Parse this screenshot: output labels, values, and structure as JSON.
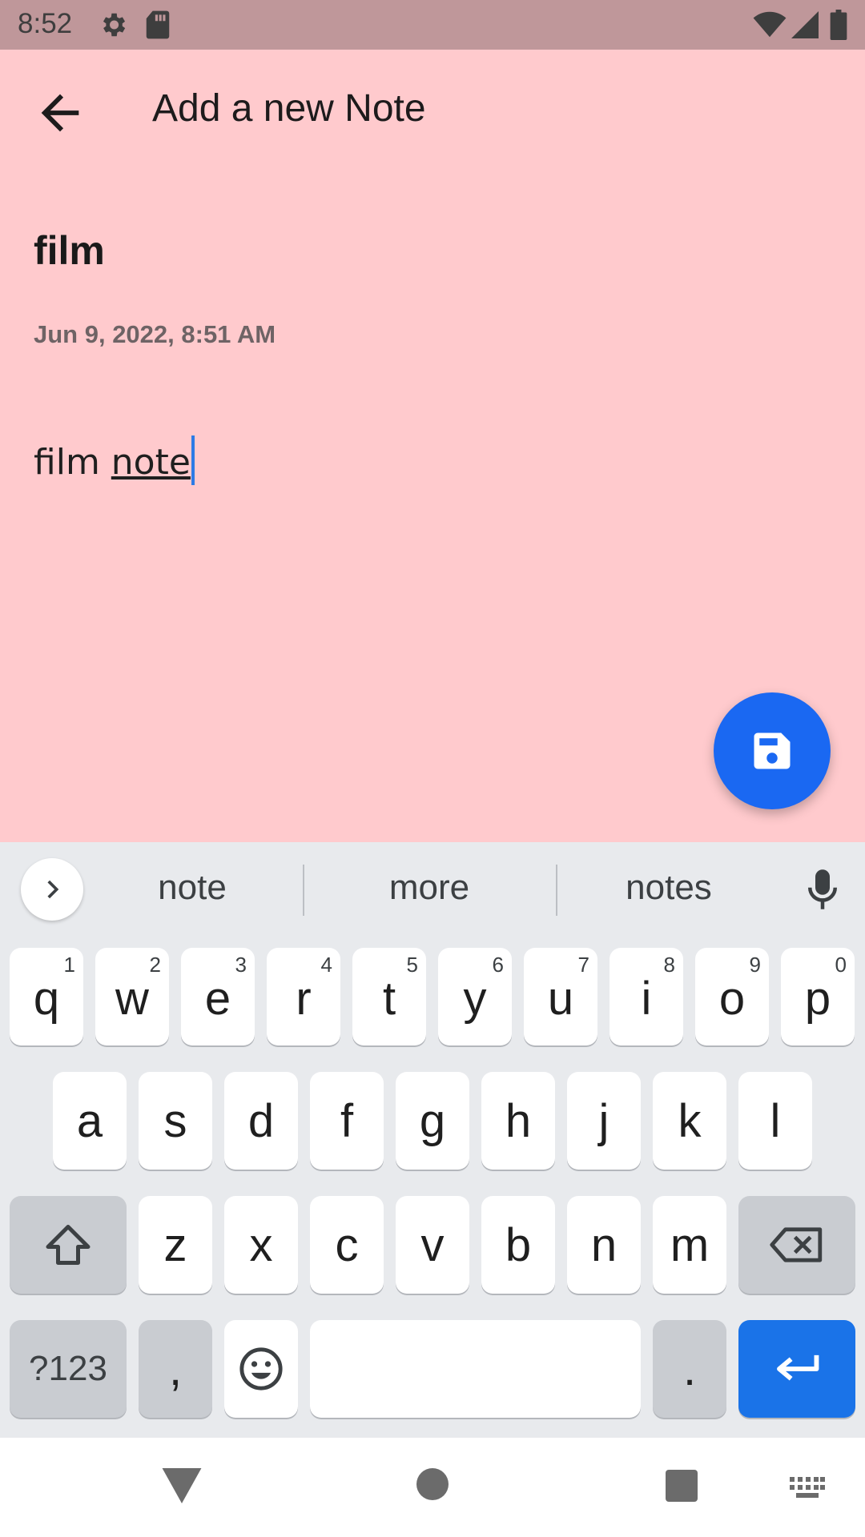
{
  "status_bar": {
    "time": "8:52",
    "icons": [
      "settings-icon",
      "sd-card-icon",
      "wifi-icon",
      "signal-icon",
      "battery-icon"
    ]
  },
  "app_bar": {
    "title": "Add a new Note",
    "back_icon": "arrow-back-icon"
  },
  "note": {
    "title": "film",
    "date": "Jun 9, 2022, 8:51 AM",
    "body_plain": "film ",
    "body_composing": "note"
  },
  "fab": {
    "icon": "save-icon",
    "color": "#1a68f2"
  },
  "keyboard": {
    "suggestions": [
      "note",
      "more",
      "notes"
    ],
    "row1": [
      {
        "k": "q",
        "h": "1"
      },
      {
        "k": "w",
        "h": "2"
      },
      {
        "k": "e",
        "h": "3"
      },
      {
        "k": "r",
        "h": "4"
      },
      {
        "k": "t",
        "h": "5"
      },
      {
        "k": "y",
        "h": "6"
      },
      {
        "k": "u",
        "h": "7"
      },
      {
        "k": "i",
        "h": "8"
      },
      {
        "k": "o",
        "h": "9"
      },
      {
        "k": "p",
        "h": "0"
      }
    ],
    "row2": [
      "a",
      "s",
      "d",
      "f",
      "g",
      "h",
      "j",
      "k",
      "l"
    ],
    "row3": [
      "z",
      "x",
      "c",
      "v",
      "b",
      "n",
      "m"
    ],
    "symbols_label": "?123",
    "comma_label": ",",
    "period_label": ".",
    "enter_color": "#1a73e8"
  },
  "colors": {
    "app_bg": "#ffcacd",
    "status_bg": "#bf979a",
    "keyboard_bg": "#e8eaed"
  }
}
